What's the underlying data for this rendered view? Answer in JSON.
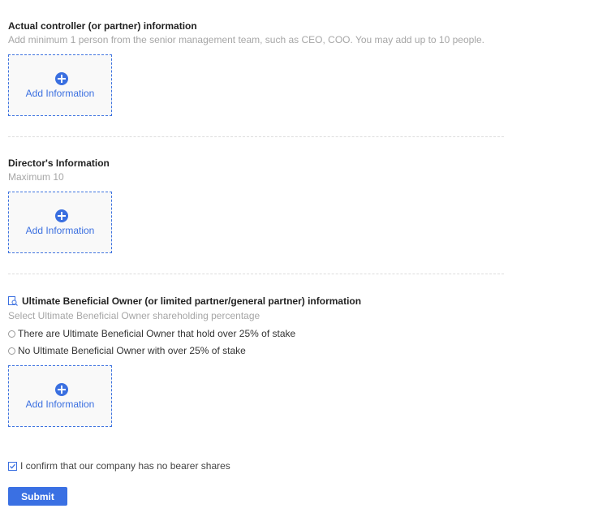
{
  "actual_controller": {
    "title": "Actual controller (or partner) information",
    "hint": "Add minimum 1 person from the senior management team, such as CEO, COO. You may add up to 10 people.",
    "add_label": "Add Information"
  },
  "directors": {
    "title": "Director's Information",
    "hint": "Maximum 10",
    "add_label": "Add Information"
  },
  "ubo": {
    "icon": "search-document-icon",
    "title": "Ultimate Beneficial Owner (or limited partner/general partner) information",
    "hint": "Select Ultimate Beneficial Owner shareholding percentage",
    "options": [
      {
        "label": "There are Ultimate Beneficial Owner that hold over 25% of stake",
        "selected": false
      },
      {
        "label": "No Ultimate Beneficial Owner with over 25% of stake",
        "selected": false
      }
    ],
    "add_label": "Add Information"
  },
  "confirm": {
    "label": "I confirm that our company has no bearer shares",
    "checked": true
  },
  "submit_label": "Submit",
  "colors": {
    "accent": "#3a6fe0",
    "title_text": "#222222",
    "hint_text": "#a6a6a6",
    "box_background": "#f9f9f9",
    "divider": "#dddddd"
  }
}
